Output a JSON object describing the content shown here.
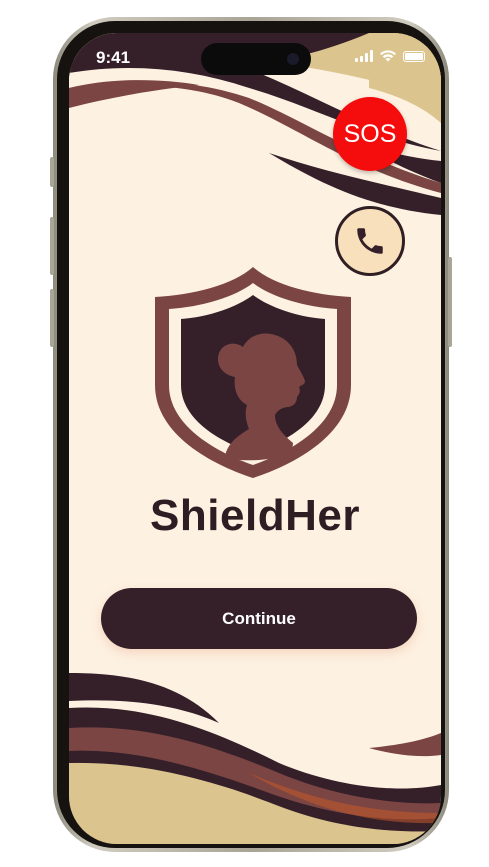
{
  "status_bar": {
    "time": "9:41"
  },
  "sos_button": {
    "label": "SOS"
  },
  "call_button": {
    "icon": "phone-icon"
  },
  "logo": {
    "icon": "shield-woman-icon"
  },
  "app": {
    "name": "ShieldHer"
  },
  "continue_button": {
    "label": "Continue"
  },
  "colors": {
    "background": "#fdf1e1",
    "dark": "#35202a",
    "accent": "#7b4543",
    "sand": "#dcc48e",
    "sos": "#f50c0c",
    "call_bg": "#f7e0bb"
  }
}
